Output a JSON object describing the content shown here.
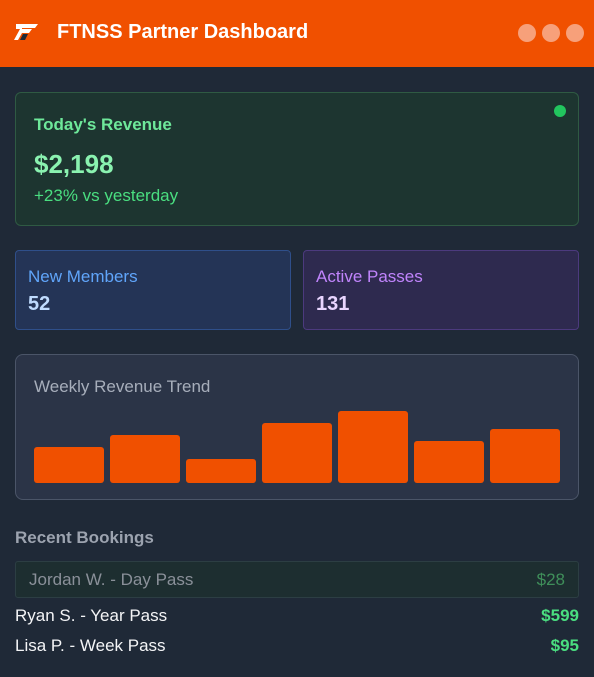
{
  "header": {
    "title": "FTNSS Partner Dashboard",
    "accent": "#f05000"
  },
  "revenue": {
    "label": "Today's Revenue",
    "value": "$2,198",
    "delta": "+23% vs yesterday",
    "status": "live"
  },
  "stats": [
    {
      "label": "New Members",
      "value": "52",
      "color": "#60a5fa"
    },
    {
      "label": "Active Passes",
      "value": "131",
      "color": "#c084fc"
    }
  ],
  "trend": {
    "title": "Weekly Revenue Trend"
  },
  "chart_data": {
    "type": "bar",
    "values": [
      36,
      48,
      24,
      60,
      72,
      42,
      54
    ],
    "ylim": [
      0,
      78
    ],
    "grid": false
  },
  "bookings": {
    "title": "Recent Bookings",
    "items": [
      {
        "text": "Jordan W. - Day Pass",
        "amount": "$28"
      },
      {
        "text": "Ryan S. - Year Pass",
        "amount": "$599"
      },
      {
        "text": "Lisa P. - Week Pass",
        "amount": "$95"
      }
    ]
  }
}
